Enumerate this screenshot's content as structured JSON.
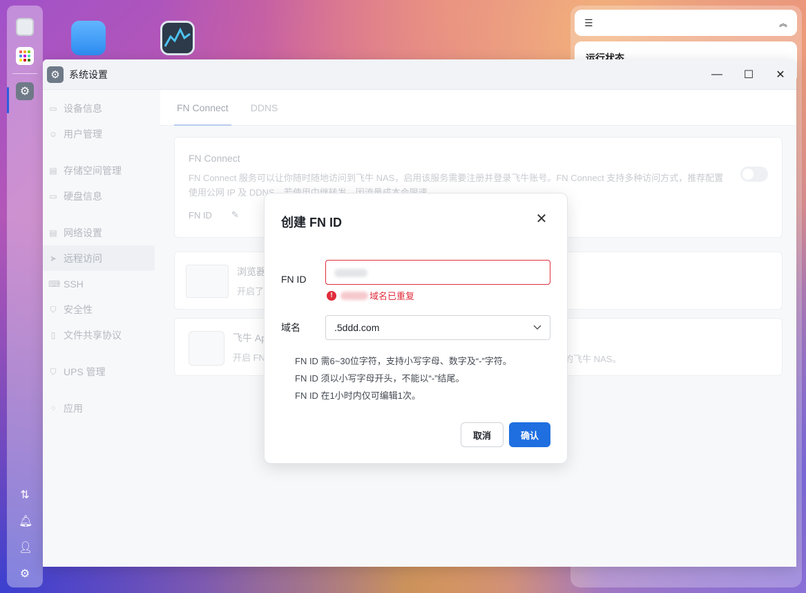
{
  "colors": {
    "accent": "#1f6fe0",
    "error": "#e02d3c"
  },
  "dock": {
    "icons": [
      "monitor-icon",
      "apps-grid-icon",
      "settings-gear-icon"
    ],
    "bottom_icons": [
      "transfer-icon",
      "bell-icon",
      "user-icon",
      "gear-icon"
    ]
  },
  "desktop": {
    "icons": [
      "files-app-icon",
      "resource-monitor-app-icon"
    ]
  },
  "widget": {
    "card_title": "运行状态"
  },
  "window": {
    "title": "系统设置",
    "controls": {
      "minimize": "—",
      "maximize": "☐",
      "close": "✕"
    }
  },
  "sidebar": {
    "items": [
      {
        "label": "设备信息",
        "icon": "▭"
      },
      {
        "label": "用户管理",
        "icon": "☺"
      },
      {
        "label": "存储空间管理",
        "icon": "▤"
      },
      {
        "label": "硬盘信息",
        "icon": "▭"
      },
      {
        "label": "网络设置",
        "icon": "▤"
      },
      {
        "label": "远程访问",
        "icon": "➤"
      },
      {
        "label": "SSH",
        "icon": "⌨"
      },
      {
        "label": "安全性",
        "icon": "⛉"
      },
      {
        "label": "文件共享协议",
        "icon": "▯"
      },
      {
        "label": "UPS 管理",
        "icon": "⛉"
      },
      {
        "label": "应用",
        "icon": "⁘"
      }
    ]
  },
  "tabs": [
    {
      "label": "FN Connect"
    },
    {
      "label": "DDNS"
    }
  ],
  "fn_connect_card": {
    "title": "FN Connect",
    "description": "FN Connect 服务可以让你随时随地访问到飞牛 NAS，启用该服务需要注册并登录飞牛账号。FN Connect 支持多种访问方式，推荐配置使用公网 IP 及 DDNS，若使用中继转发，因流量成本会限速。",
    "fn_id_label": "FN ID"
  },
  "browser_card": {
    "title": "浏览器",
    "desc": "开启了"
  },
  "app_card": {
    "title": "飞牛 Ap",
    "desc": "开启 FN",
    "tail": "的飞牛 NAS。"
  },
  "dialog": {
    "title": "创建 FN ID",
    "fn_id_label": "FN ID",
    "error_text": "域名已重复",
    "domain_label": "域名",
    "domain_value": ".5ddd.com",
    "hints": [
      "FN ID 需6~30位字符，支持小写字母、数字及“-”字符。",
      "FN ID 须以小写字母开头，不能以“-”结尾。",
      "FN ID 在1小时内仅可编辑1次。"
    ],
    "cancel": "取消",
    "confirm": "确认"
  }
}
